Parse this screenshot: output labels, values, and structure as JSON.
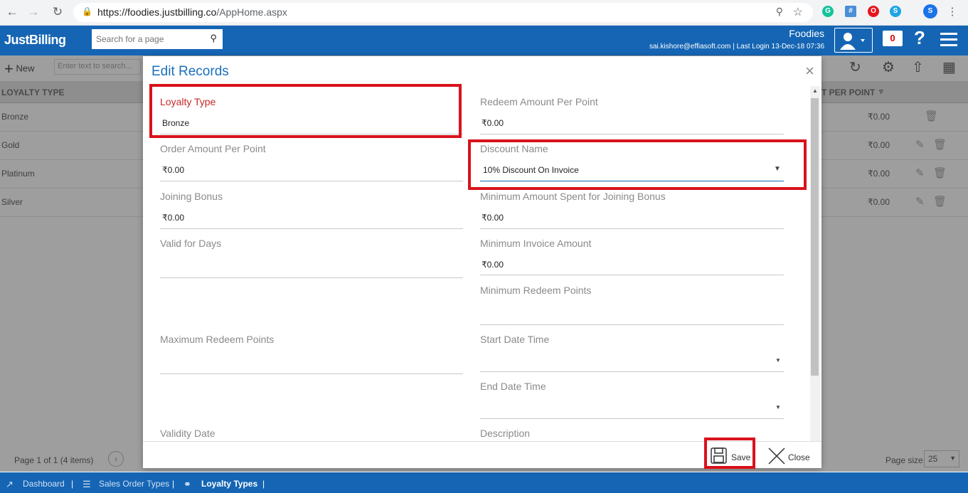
{
  "browser": {
    "url_host": "https://foodies.justbilling.co",
    "url_path": "/AppHome.aspx"
  },
  "header": {
    "logo": "JustBilling",
    "search_placeholder": "Search for a page",
    "company": "Foodies",
    "user_line": "sai.kishore@effiasoft.com | Last Login 13-Dec-18 07:36",
    "notification_count": "0"
  },
  "toolbar": {
    "new_label": "New",
    "search_placeholder": "Enter text to search..."
  },
  "grid": {
    "col_loyalty_type": "LOYALTY TYPE",
    "col_redeem": "T PER POINT",
    "rows": [
      {
        "type": "Bronze",
        "value": "₹0.00"
      },
      {
        "type": "Gold",
        "value": "₹0.00"
      },
      {
        "type": "Platinum",
        "value": "₹0.00"
      },
      {
        "type": "Silver",
        "value": "₹0.00"
      }
    ],
    "page_info": "Page 1 of 1 (4 items)",
    "page_size_label": "Page size:",
    "page_size_value": "25"
  },
  "bottom_nav": {
    "dashboard": "Dashboard",
    "sales_order_types": "Sales Order Types",
    "loyalty_types": "Loyalty Types"
  },
  "modal": {
    "title": "Edit Records",
    "loyalty_type_label": "Loyalty Type",
    "loyalty_type_value": "Bronze",
    "redeem_amount_label": "Redeem Amount Per Point",
    "redeem_amount_value": "₹0.00",
    "order_amount_label": "Order Amount Per Point",
    "order_amount_value": "₹0.00",
    "discount_name_label": "Discount Name",
    "discount_name_value": "10% Discount On Invoice",
    "joining_bonus_label": "Joining Bonus",
    "joining_bonus_value": "₹0.00",
    "min_spent_label": "Minimum Amount Spent for Joining Bonus",
    "min_spent_value": "₹0.00",
    "valid_days_label": "Valid for Days",
    "min_invoice_label": "Minimum Invoice Amount",
    "min_invoice_value": "₹0.00",
    "min_redeem_label": "Minimum Redeem Points",
    "max_redeem_label": "Maximum Redeem Points",
    "start_date_label": "Start Date Time",
    "end_date_label": "End Date Time",
    "validity_date_label": "Validity Date",
    "description_label": "Description",
    "save_label": "Save",
    "close_label": "Close"
  }
}
